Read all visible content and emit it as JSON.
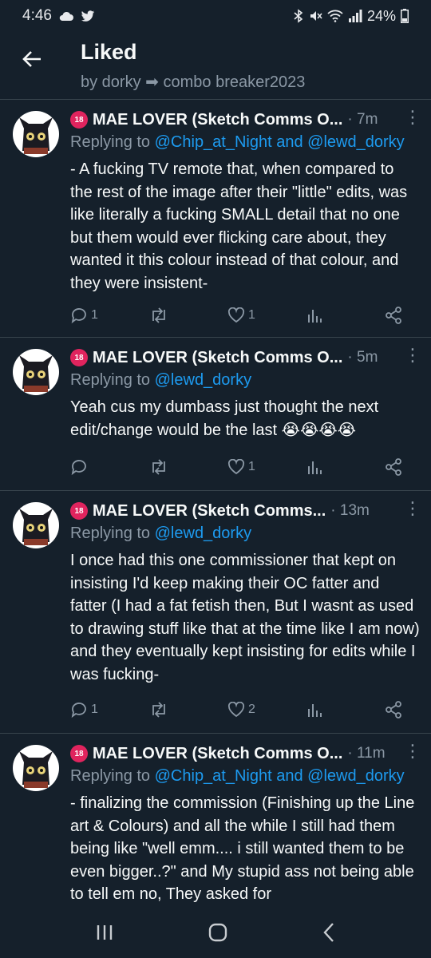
{
  "status_bar": {
    "time": "4:46",
    "battery": "24%",
    "icons": [
      "cloud-icon",
      "twitter-bird-icon",
      "bluetooth-icon",
      "mute-icon",
      "wifi-icon",
      "signal-icon",
      "battery-icon"
    ]
  },
  "header": {
    "title": "Liked",
    "subtitle_prefix": "by dorky",
    "subtitle_emoji": "➡",
    "subtitle_suffix": "combo breaker2023"
  },
  "tweets": [
    {
      "name": "MAE LOVER (Sketch Comms O...",
      "badge": "18",
      "time": "· 7m",
      "reply_prefix": "Replying to ",
      "reply_mentions": "@Chip_at_Night and @lewd_dorky",
      "text": "- A fucking TV remote that, when compared to the rest of the image after their \"little\" edits, was like literally a fucking SMALL detail that no one but them would ever flicking care about, they wanted it this colour instead of that colour, and they were insistent-",
      "replies": "1",
      "retweets": "",
      "likes": "1"
    },
    {
      "name": "MAE LOVER (Sketch Comms O...",
      "badge": "18",
      "time": "· 5m",
      "reply_prefix": "Replying to ",
      "reply_mentions": "@lewd_dorky",
      "text": "Yeah cus my dumbass just thought the next edit/change would be the last 😭😭😭😭",
      "replies": "",
      "retweets": "",
      "likes": "1"
    },
    {
      "name": "MAE LOVER (Sketch Comms...",
      "badge": "18",
      "time": "· 13m",
      "reply_prefix": "Replying to ",
      "reply_mentions": "@lewd_dorky",
      "text": "I once had this one commissioner that kept on insisting I'd keep making their OC fatter and fatter (I had a fat fetish then, But I wasnt as used to drawing stuff like that at the time like I am now) and they eventually kept insisting for edits while I was fucking-",
      "replies": "1",
      "retweets": "",
      "likes": "2"
    },
    {
      "name": "MAE LOVER (Sketch Comms O...",
      "badge": "18",
      "time": "· 11m",
      "reply_prefix": "Replying to ",
      "reply_mentions": "@Chip_at_Night and @lewd_dorky",
      "text": "- finalizing the commission (Finishing up the Line art & Colours) and all the while I still had them being like \"well emm.... i still wanted them to be even bigger..?\" and My stupid ass not being able to tell em no, They asked for",
      "replies": "",
      "retweets": "",
      "likes": ""
    }
  ]
}
